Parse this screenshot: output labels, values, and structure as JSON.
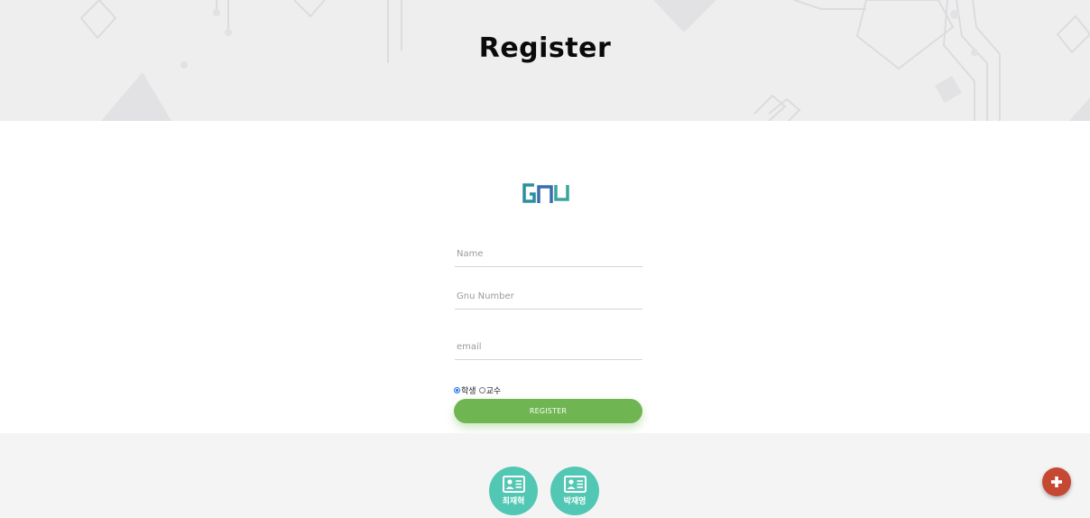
{
  "header": {
    "title": "Register"
  },
  "logo": {
    "icon": "gnu-logo",
    "colors": [
      "#2b8fa0",
      "#3a6db0",
      "#3aa6a0"
    ]
  },
  "form": {
    "name": {
      "placeholder": "Name",
      "value": ""
    },
    "gnu_number": {
      "placeholder": "Gnu Number",
      "value": ""
    },
    "email": {
      "placeholder": "email",
      "value": ""
    },
    "roles": [
      {
        "label": "학생",
        "selected": true
      },
      {
        "label": "교수",
        "selected": false
      }
    ],
    "register_label": "REGISTER"
  },
  "footer": {
    "members": [
      {
        "name": "최재혁",
        "icon": "id-card-icon"
      },
      {
        "name": "박재영",
        "icon": "id-card-icon"
      }
    ],
    "fab_icon": "plus-icon"
  },
  "colors": {
    "accent_green": "#6fb552",
    "member_teal": "#52c7b3",
    "fab_red": "#c64833",
    "banner_bg": "#eeeeef",
    "footer_bg": "#f4f4f4"
  }
}
